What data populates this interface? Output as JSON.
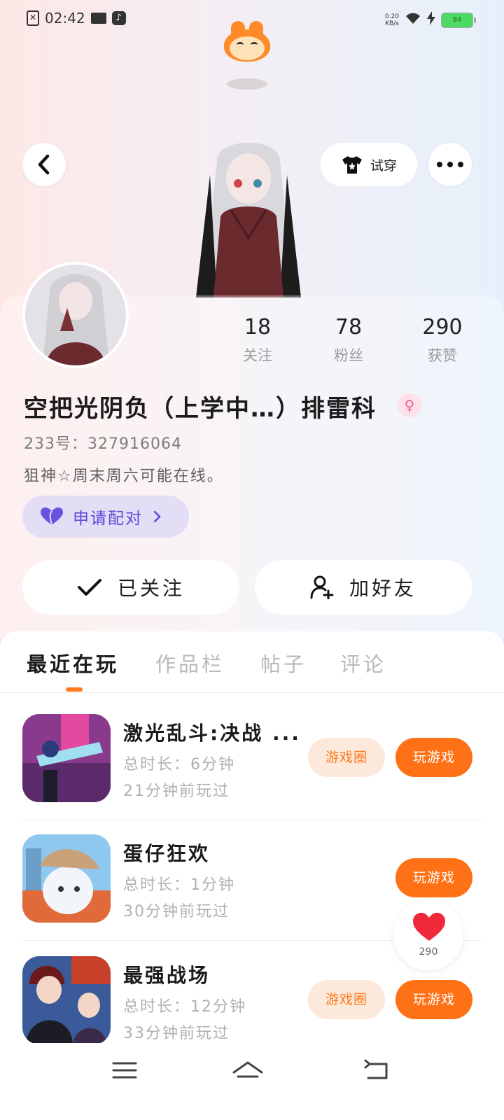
{
  "status_bar": {
    "time": "02:42",
    "net_speed_top": "0.20",
    "net_speed_bottom": "KB/s",
    "battery": "84"
  },
  "header": {
    "tryon_label": "试穿"
  },
  "profile": {
    "stats": [
      {
        "value": "18",
        "label": "关注"
      },
      {
        "value": "78",
        "label": "粉丝"
      },
      {
        "value": "290",
        "label": "获赞"
      }
    ],
    "nickname": "空把光阴负（上学中…）排雷科",
    "uid": "233号：327916064",
    "bio": "狙神☆周末周六可能在线。",
    "pair_label": "申请配对",
    "followed_label": "已关注",
    "add_friend_label": "加好友"
  },
  "tabs": [
    {
      "label": "最近在玩",
      "active": true
    },
    {
      "label": "作品栏",
      "active": false
    },
    {
      "label": "帖子",
      "active": false
    },
    {
      "label": "评论",
      "active": false
    }
  ],
  "games": [
    {
      "title": "激光乱斗:决战 ...",
      "duration": "总时长：6分钟",
      "last_played": "21分钟前玩过",
      "circle_label": "游戏圈",
      "play_label": "玩游戏"
    },
    {
      "title": "蛋仔狂欢",
      "duration": "总时长：1分钟",
      "last_played": "30分钟前玩过",
      "play_label": "玩游戏"
    },
    {
      "title": "最强战场",
      "duration": "总时长：12分钟",
      "last_played": "33分钟前玩过",
      "circle_label": "游戏圈",
      "play_label": "玩游戏"
    }
  ],
  "like_float": {
    "count": "290"
  },
  "colors": {
    "accent": "#ff7116",
    "pair_purple": "#5b4bd8",
    "heart_red": "#f0283c"
  }
}
